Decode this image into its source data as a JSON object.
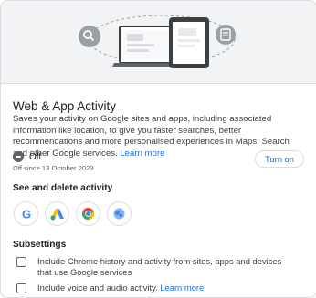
{
  "header": {
    "title": "Web & App Activity",
    "description": "Saves your activity on Google sites and apps, including associated information like location, to give you faster searches, better recommendations and more personalised experiences in Maps, Search and other Google services.",
    "learn_more": "Learn more"
  },
  "status": {
    "label": "Off",
    "since": "Off since 13 October 2023",
    "turn_on_label": "Turn on"
  },
  "see_and_delete": {
    "title": "See and delete activity",
    "apps": [
      {
        "name": "google",
        "icon": "google-icon"
      },
      {
        "name": "google-ads",
        "icon": "google-ads-icon"
      },
      {
        "name": "chrome",
        "icon": "chrome-icon"
      },
      {
        "name": "google-analytics",
        "icon": "analytics-icon"
      }
    ]
  },
  "subsettings": {
    "title": "Subsettings",
    "items": [
      {
        "label": "Include Chrome history and activity from sites, apps and devices that use Google services",
        "checked": false
      },
      {
        "label": "Include voice and audio activity.",
        "link": "Learn more",
        "checked": false
      }
    ]
  },
  "colors": {
    "accent": "#1a73e8",
    "hero_bg": "#f1f3f4",
    "border": "#dadce0"
  }
}
